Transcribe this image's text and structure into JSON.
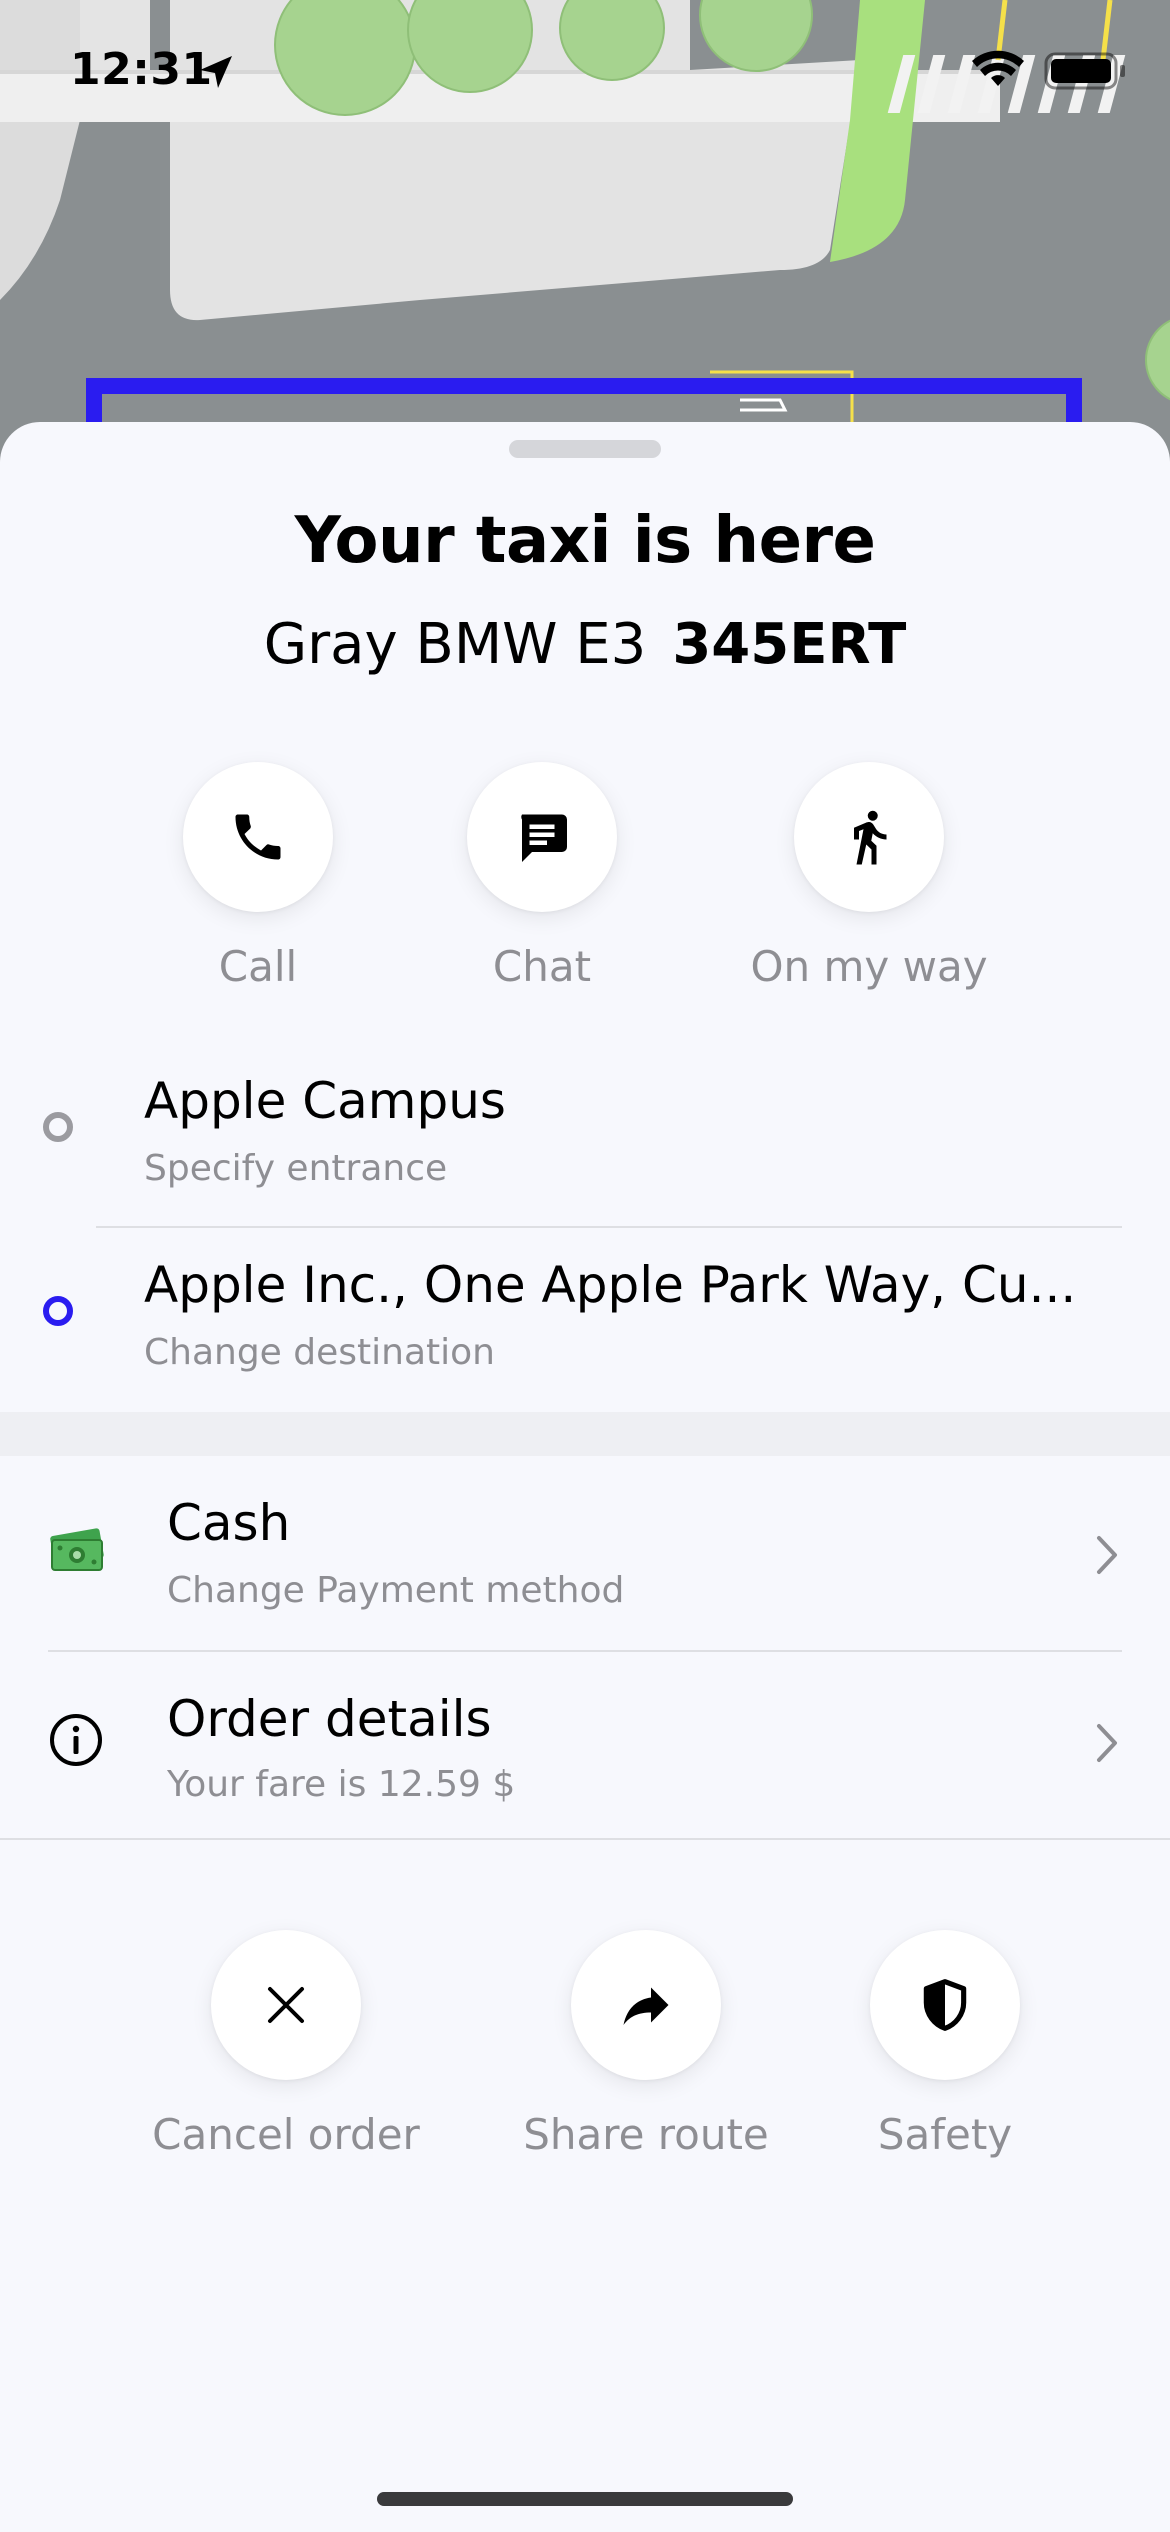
{
  "status_bar": {
    "time": "12:31"
  },
  "sheet": {
    "title": "Your taxi is here",
    "car_model": "Gray BMW E3",
    "car_plate": "345ERT"
  },
  "quick_actions": [
    {
      "label": "Call",
      "icon": "phone-icon"
    },
    {
      "label": "Chat",
      "icon": "chat-icon"
    },
    {
      "label": "On my way",
      "icon": "walking-icon"
    }
  ],
  "route": {
    "pickup": {
      "title": "Apple Campus",
      "subtitle": "Specify entrance"
    },
    "destination": {
      "title": "Apple Inc., One Apple Park Way, Cu...",
      "subtitle": "Change destination"
    }
  },
  "payment": {
    "title": "Cash",
    "subtitle": "Change Payment method",
    "icon": "cash-icon"
  },
  "order_details": {
    "title": "Order details",
    "subtitle": "Your fare is 12.59 $",
    "icon": "info-icon"
  },
  "bottom_actions": [
    {
      "label": "Cancel order",
      "icon": "close-icon"
    },
    {
      "label": "Share route",
      "icon": "share-arrow-icon"
    },
    {
      "label": "Safety",
      "icon": "shield-icon"
    }
  ],
  "colors": {
    "accent": "#2a1cf0",
    "sheet_background": "#f7f8fd",
    "secondary_text": "#8e8e93",
    "map_road": "#8a8f91",
    "map_block": "#e3e3e3",
    "tree": "#a6d38f",
    "park_strip": "#a8e07e"
  }
}
